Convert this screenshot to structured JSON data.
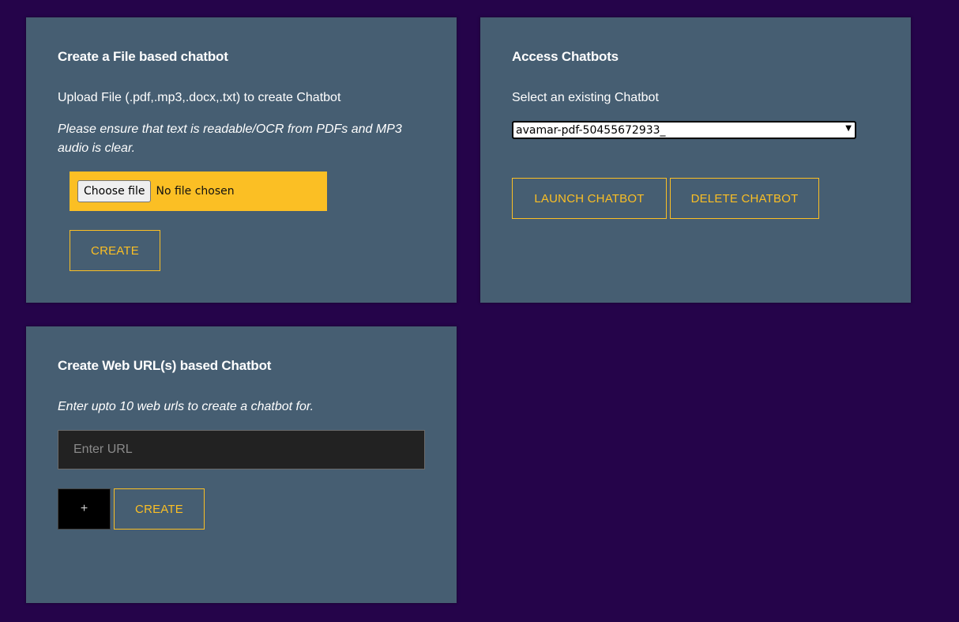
{
  "file_card": {
    "title": "Create a File based chatbot",
    "upload_text": "Upload File (.pdf,.mp3,.docx,.txt) to create Chatbot",
    "notice_text": "Please ensure that text is readable/OCR from PDFs and MP3 audio is clear.",
    "choose_file_label": "Choose file",
    "no_file_text": "No file chosen",
    "create_label": "CREATE"
  },
  "access_card": {
    "title": "Access Chatbots",
    "select_label": "Select an existing Chatbot",
    "selected_chatbot": "avamar-pdf-50455672933_",
    "launch_label": "LAUNCH CHATBOT",
    "delete_label": "DELETE CHATBOT"
  },
  "web_card": {
    "title": "Create Web URL(s) based Chatbot",
    "instruction": "Enter upto 10 web urls to create a chatbot for.",
    "url_placeholder": "Enter URL",
    "add_label": "+",
    "create_label": "CREATE"
  },
  "colors": {
    "background": "#25044a",
    "card": "#465e72",
    "accent": "#fbbf24"
  }
}
